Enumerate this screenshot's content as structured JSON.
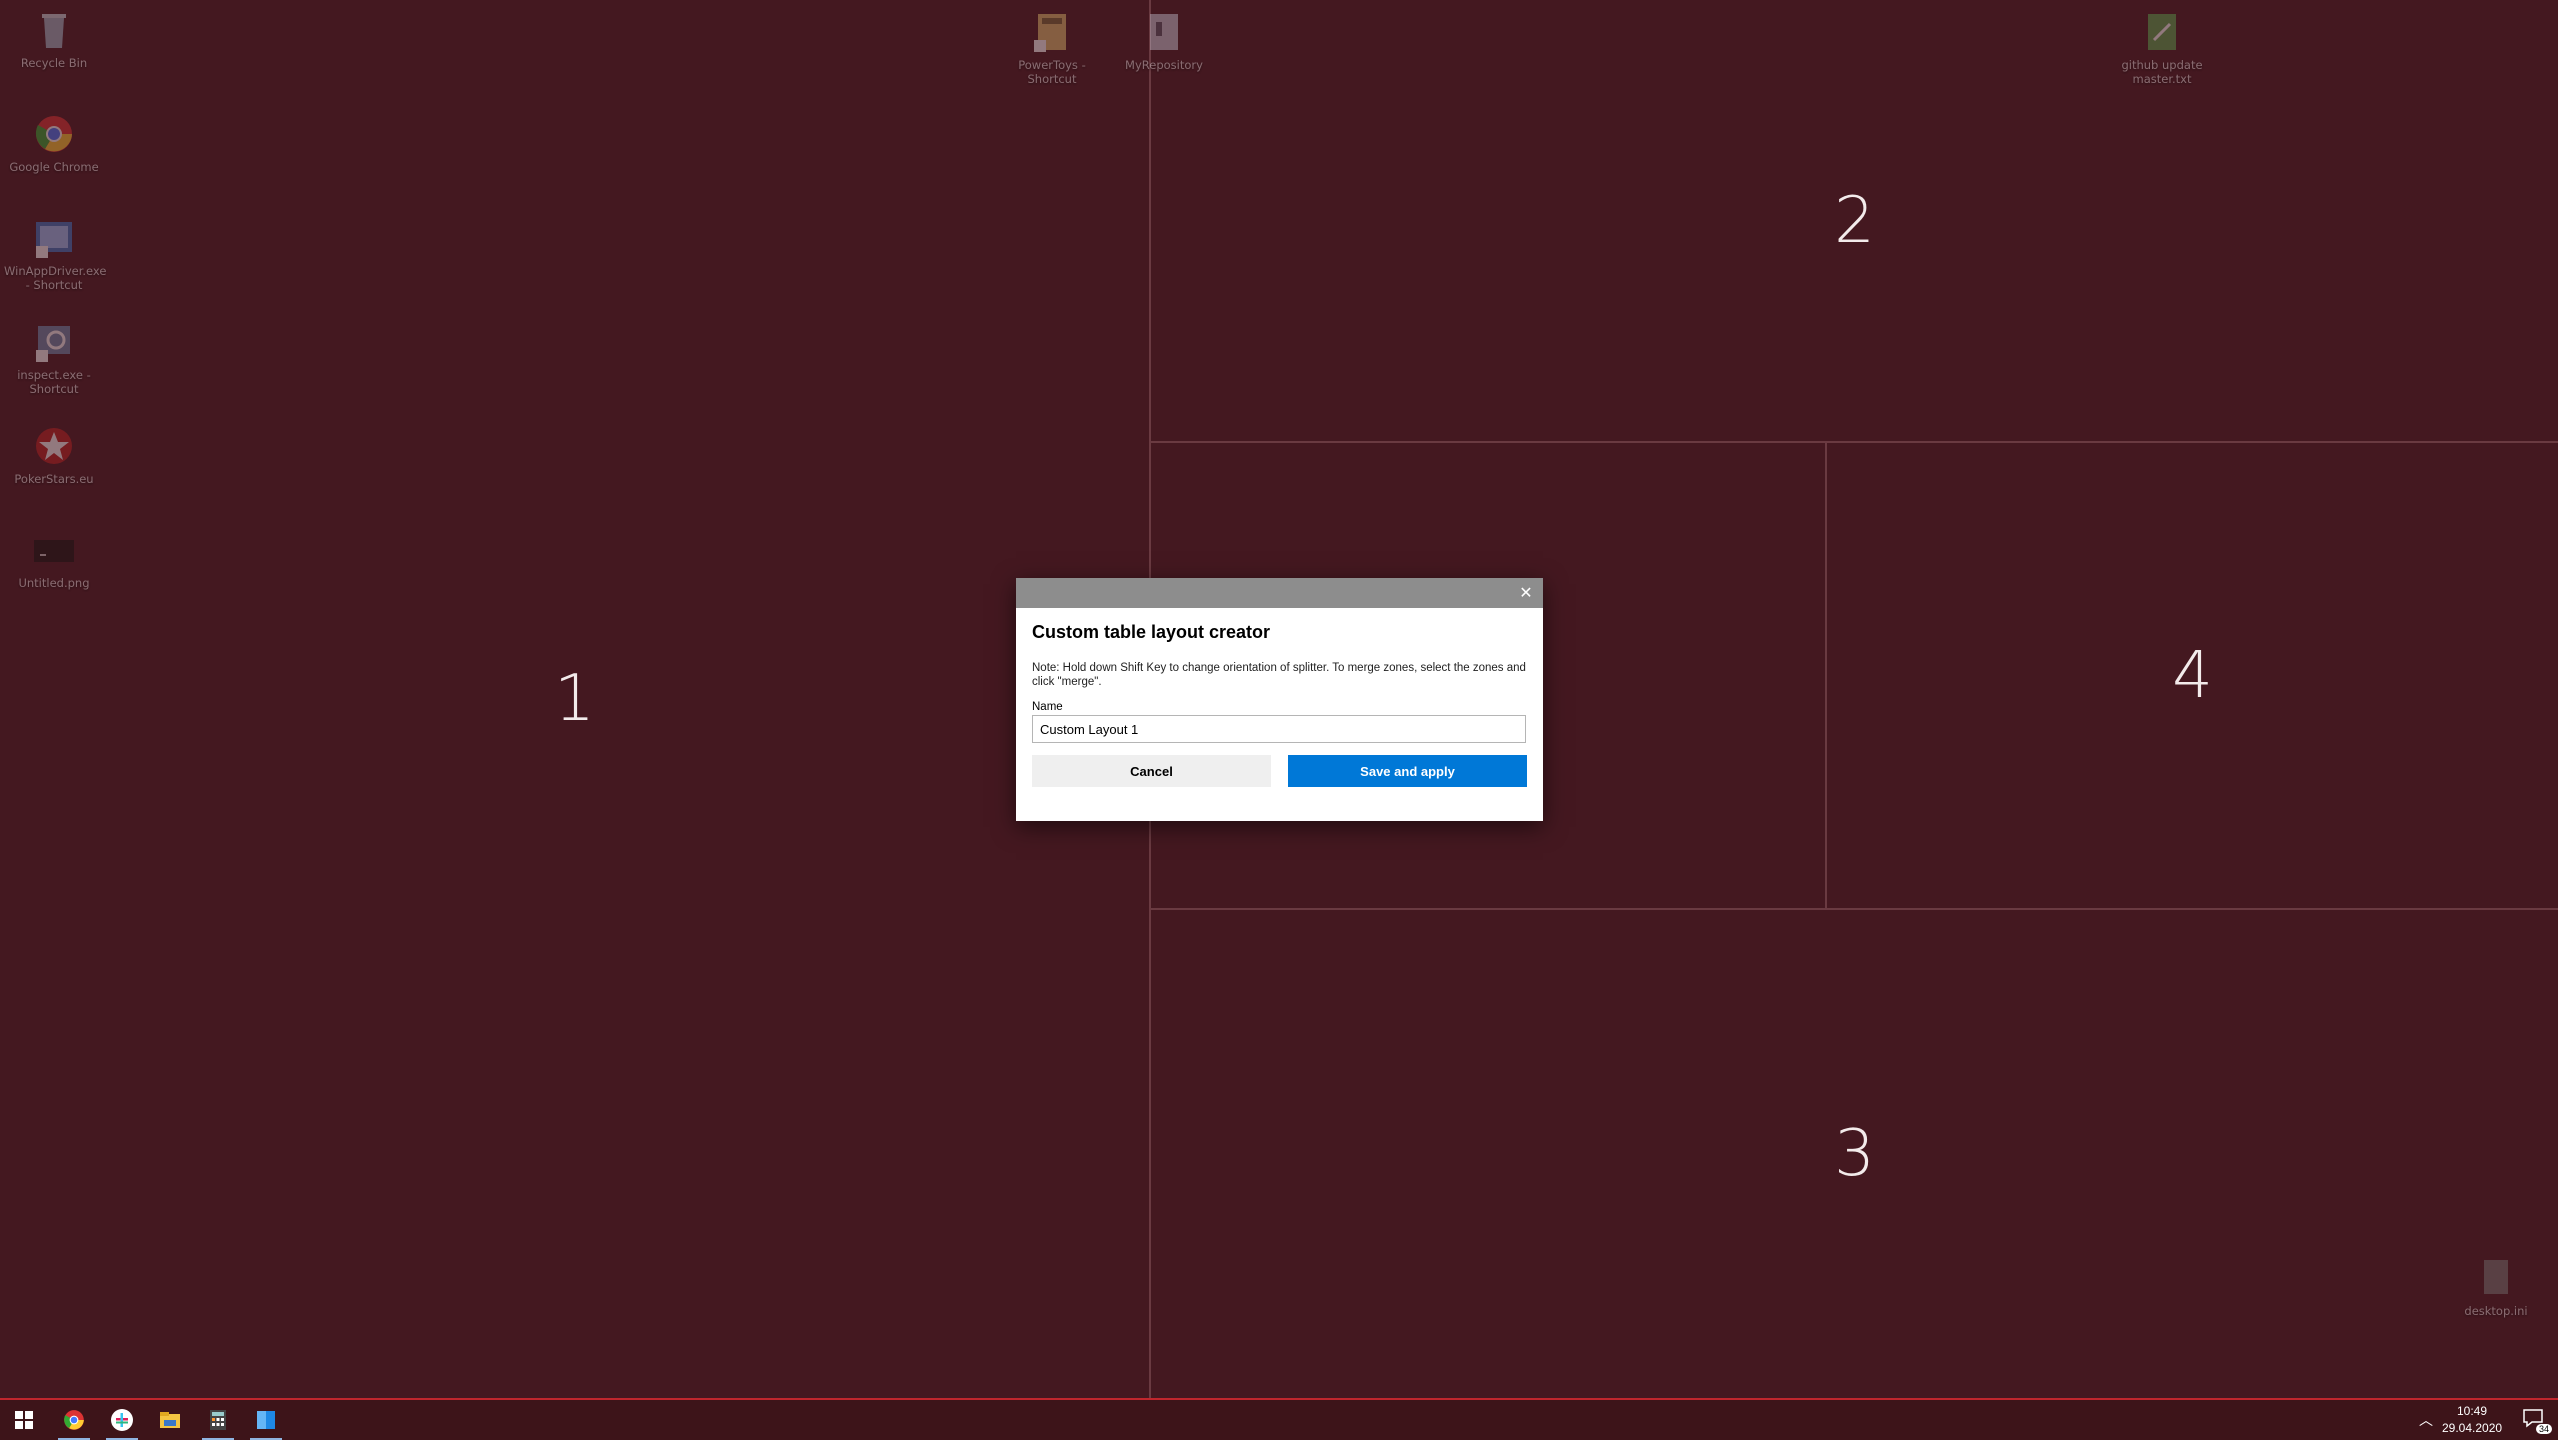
{
  "desktop": {
    "icons": [
      {
        "label": "Recycle Bin",
        "icon": "recycle-bin-icon"
      },
      {
        "label": "Google Chrome",
        "icon": "chrome-icon"
      },
      {
        "label": "WinAppDriver.exe - Shortcut",
        "icon": "app-shortcut-icon"
      },
      {
        "label": "inspect.exe - Shortcut",
        "icon": "inspect-icon"
      },
      {
        "label": "PokerStars.eu",
        "icon": "pokerstars-icon"
      },
      {
        "label": "Untitled.png",
        "icon": "image-file-icon"
      },
      {
        "label": "PowerToys - Shortcut",
        "icon": "folder-shortcut-icon"
      },
      {
        "label": "MyRepository",
        "icon": "repository-icon"
      },
      {
        "label": "github update master.txt",
        "icon": "text-file-icon"
      },
      {
        "label": "desktop.ini",
        "icon": "ini-file-icon"
      }
    ]
  },
  "zones": {
    "z1": "1",
    "z2": "2",
    "z3": "3",
    "z4": "4"
  },
  "dialog": {
    "title": "Custom table layout creator",
    "note": "Note: Hold down Shift Key to change orientation of splitter.  To merge zones, select the zones and click \"merge\".",
    "name_label": "Name",
    "name_value": "Custom Layout 1",
    "cancel_label": "Cancel",
    "save_label": "Save and apply",
    "close_glyph": "✕"
  },
  "taskbar": {
    "time": "10:49",
    "date": "29.04.2020",
    "notification_count": "34",
    "apps": [
      "start-icon",
      "chrome-icon",
      "slack-icon",
      "file-explorer-icon",
      "calculator-icon",
      "fancyzones-editor-icon"
    ]
  },
  "colors": {
    "zone_bg": "#441820",
    "accent": "#0078d7",
    "taskbar_border": "#c0262d"
  }
}
